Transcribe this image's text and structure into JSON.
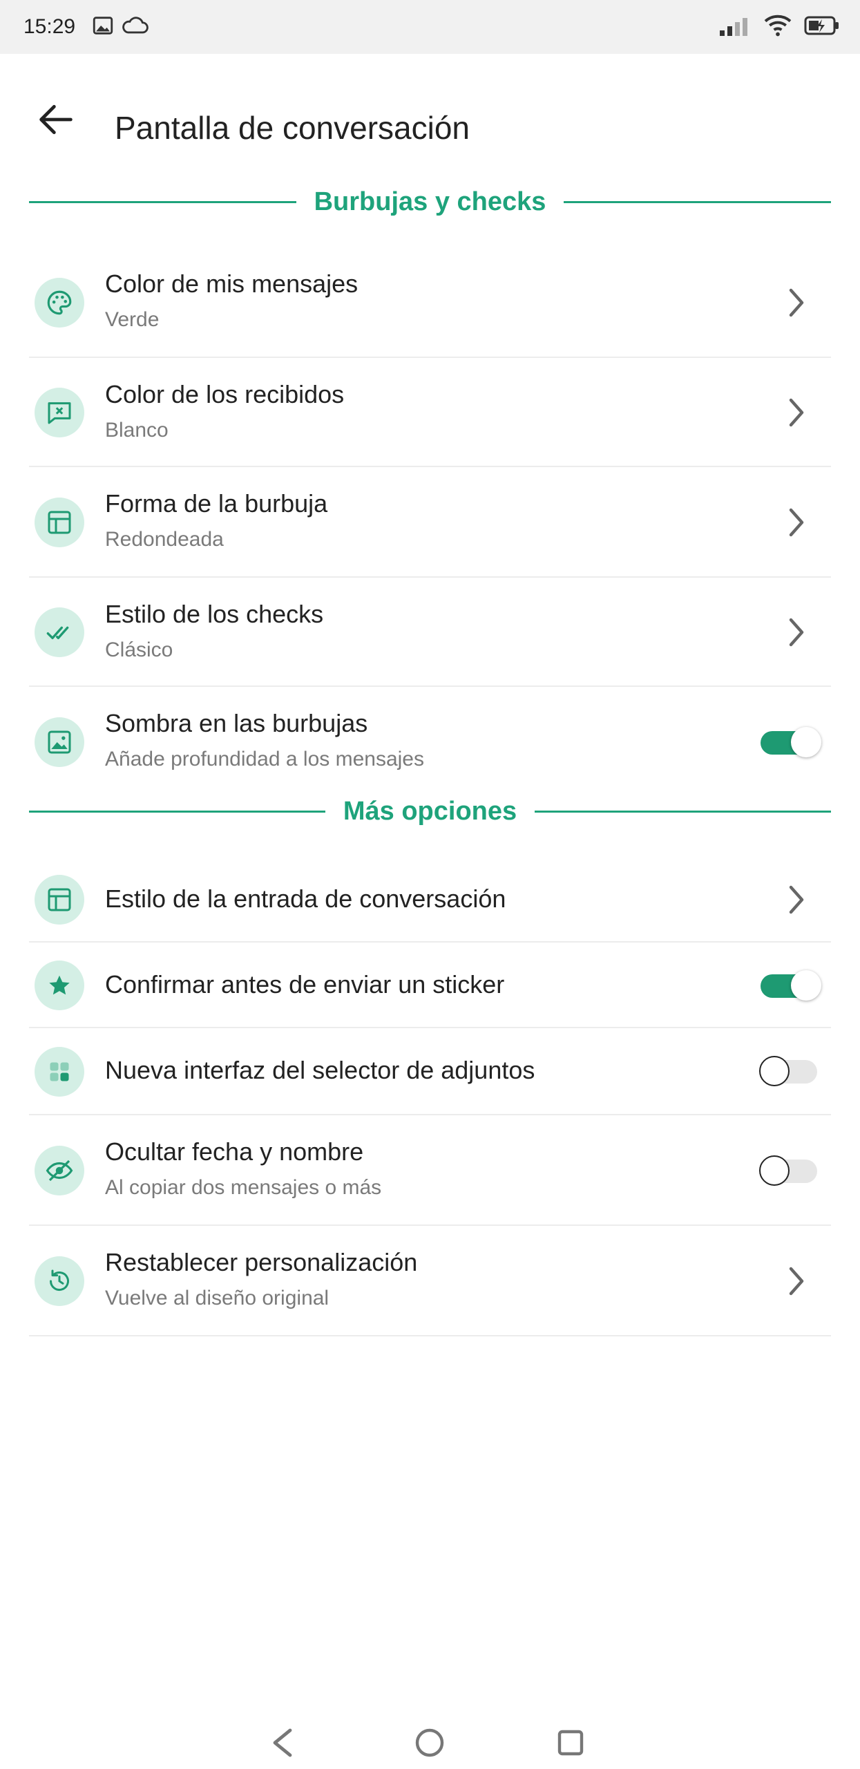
{
  "status_bar": {
    "time": "15:29",
    "left_icons": [
      "image-icon",
      "cloud-icon"
    ],
    "right_icons": [
      "signal-icon",
      "wifi-icon",
      "battery-charging-icon"
    ]
  },
  "app_bar": {
    "back_icon": "arrow-back-icon",
    "title": "Pantalla de conversación"
  },
  "colors": {
    "accent": "#1ea37b",
    "icon_bg": "#d4efe5",
    "toggle_on": "#1e9a72"
  },
  "sections": [
    {
      "label": "Burbujas y checks",
      "items": [
        {
          "icon": "palette-icon",
          "title": "Color de mis mensajes",
          "subtitle": "Verde",
          "control": "chevron"
        },
        {
          "icon": "message-x-icon",
          "title": "Color de los recibidos",
          "subtitle": "Blanco",
          "control": "chevron"
        },
        {
          "icon": "layout-icon",
          "title": "Forma de la burbuja",
          "subtitle": "Redondeada",
          "control": "chevron"
        },
        {
          "icon": "double-check-icon",
          "title": "Estilo de los checks",
          "subtitle": "Clásico",
          "control": "chevron"
        },
        {
          "icon": "image-icon",
          "title": "Sombra en las burbujas",
          "subtitle": "Añade profundidad a los mensajes",
          "control": "toggle",
          "checked": true
        }
      ]
    },
    {
      "label": "Más opciones",
      "items": [
        {
          "icon": "layout-icon",
          "title": "Estilo de la entrada de conversación",
          "control": "chevron"
        },
        {
          "icon": "star-icon",
          "title": "Confirmar antes de enviar un sticker",
          "control": "toggle",
          "checked": true
        },
        {
          "icon": "grid-icon",
          "title": "Nueva interfaz del selector de adjuntos",
          "control": "toggle",
          "checked": false
        },
        {
          "icon": "eye-off-icon",
          "title": "Ocultar fecha y nombre",
          "subtitle": "Al copiar dos mensajes o más",
          "control": "toggle",
          "checked": false
        },
        {
          "icon": "restore-icon",
          "title": "Restablecer personalización",
          "subtitle": "Vuelve al diseño original",
          "control": "chevron"
        }
      ]
    }
  ],
  "nav_bar": {
    "icons": [
      "nav-back-icon",
      "nav-home-icon",
      "nav-recents-icon"
    ]
  }
}
